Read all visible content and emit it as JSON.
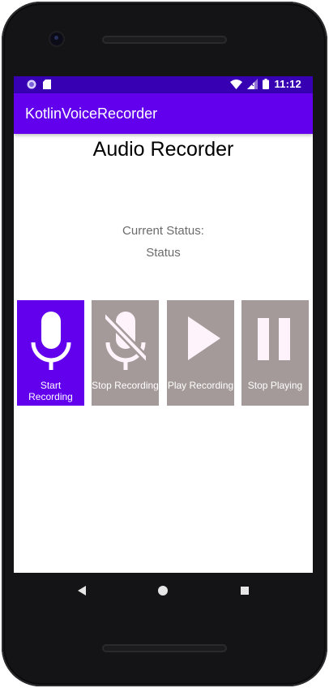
{
  "status_bar": {
    "time": "11:12"
  },
  "app": {
    "title": "KotlinVoiceRecorder"
  },
  "main": {
    "heading": "Audio Recorder",
    "status_label": "Current Status:",
    "status_value": "Status"
  },
  "buttons": [
    {
      "label": "Start Recording",
      "icon": "mic-icon",
      "enabled": true
    },
    {
      "label": "Stop Recording",
      "icon": "mic-off-icon",
      "enabled": false
    },
    {
      "label": "Play Recording",
      "icon": "play-icon",
      "enabled": false
    },
    {
      "label": "Stop Playing",
      "icon": "pause-icon",
      "enabled": false
    }
  ],
  "colors": {
    "status_bar": "#3700b3",
    "app_bar": "#6200ee",
    "button_active": "#6200ee",
    "button_inactive": "#a49a99",
    "icon_inactive": "#fff3fb"
  }
}
